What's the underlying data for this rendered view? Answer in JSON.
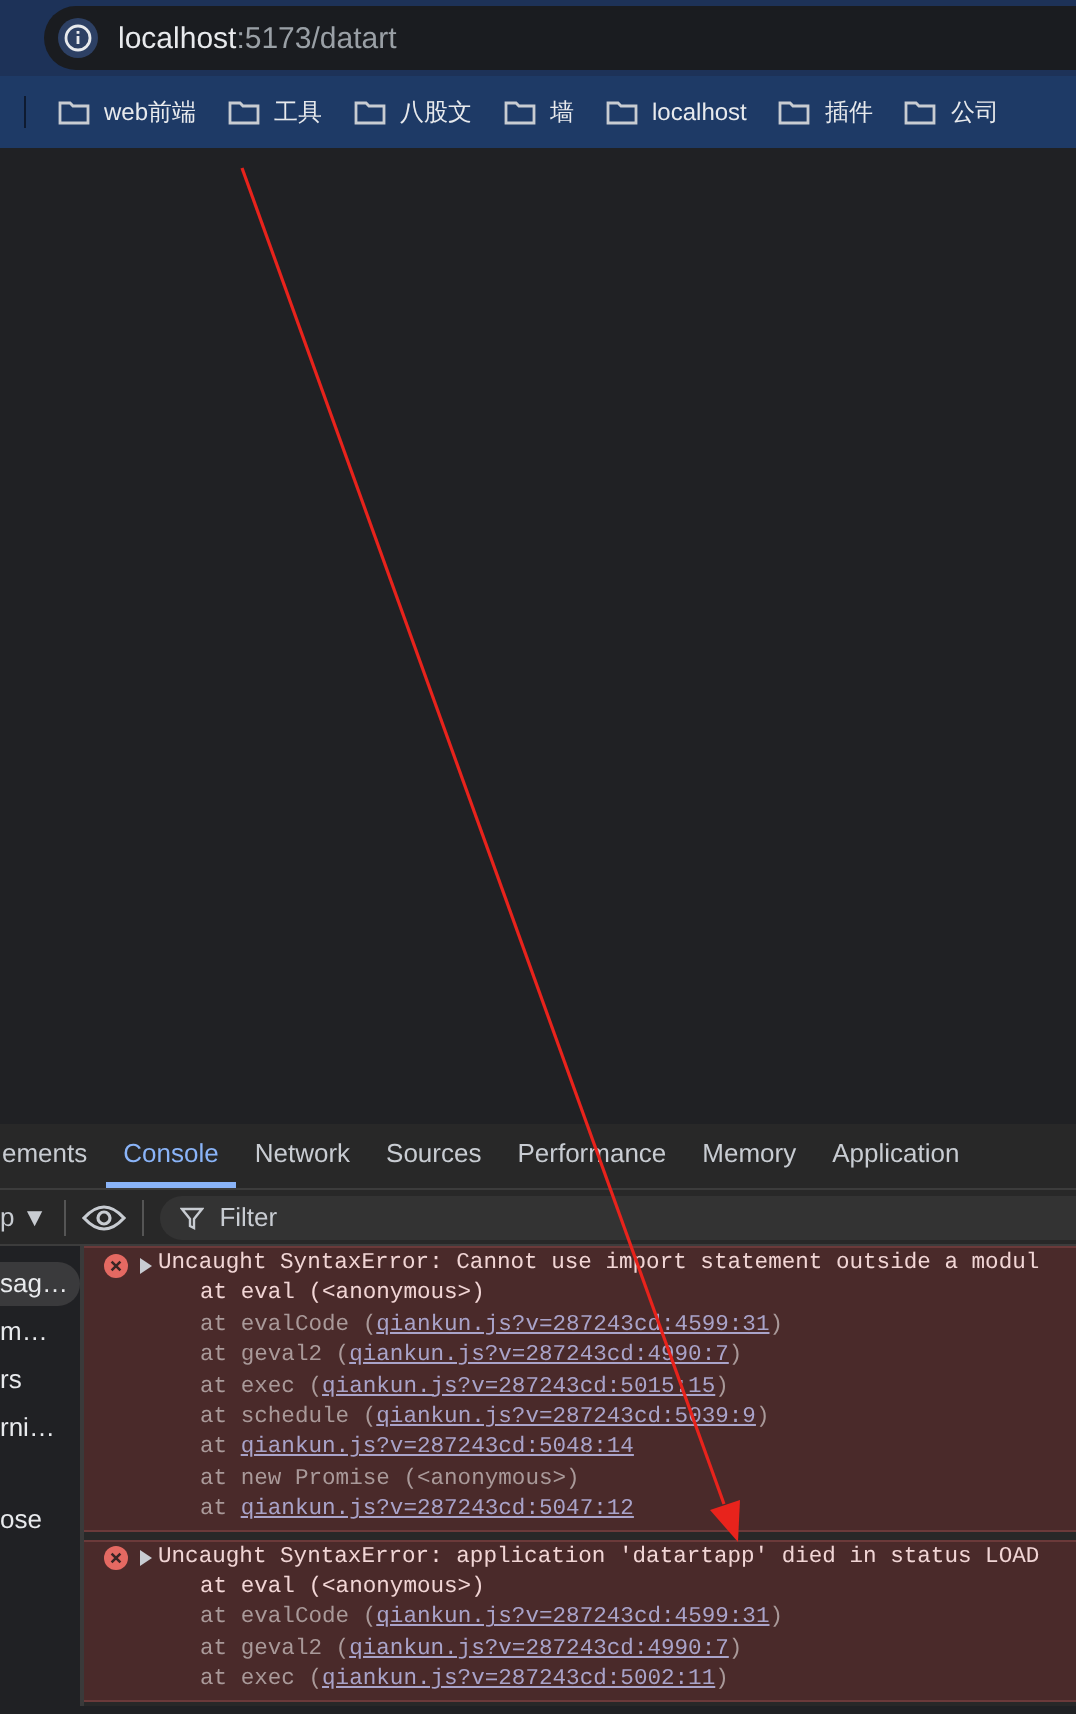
{
  "browser": {
    "address": {
      "host": "localhost",
      "path": ":5173/datart"
    },
    "bookmarks": [
      "web前端",
      "工具",
      "八股文",
      "墙",
      "localhost",
      "插件",
      "公司"
    ]
  },
  "devtools": {
    "tabs": [
      {
        "label": "ements",
        "selected": false
      },
      {
        "label": "Console",
        "selected": true
      },
      {
        "label": "Network",
        "selected": false
      },
      {
        "label": "Sources",
        "selected": false
      },
      {
        "label": "Performance",
        "selected": false
      },
      {
        "label": "Memory",
        "selected": false
      },
      {
        "label": "Application",
        "selected": false
      }
    ],
    "toolbar": {
      "context": "p ▼",
      "filter_placeholder": "Filter"
    },
    "sidebar": [
      {
        "label": "sag…",
        "selected": true
      },
      {
        "label": "m…",
        "selected": false
      },
      {
        "label": "rs",
        "selected": false
      },
      {
        "label": "rni…",
        "selected": false
      },
      {
        "label": "ose",
        "selected": false
      }
    ],
    "messages": [
      {
        "text": "Uncaught SyntaxError: Cannot use import statement outside a modul",
        "frames": [
          {
            "prefix": "at eval (<anonymous>)"
          },
          {
            "prefix": "at evalCode (",
            "link": "qiankun.js?v=287243cd:4599:31",
            "suffix": ")"
          },
          {
            "prefix": "at geval2 (",
            "link": "qiankun.js?v=287243cd:4990:7",
            "suffix": ")"
          },
          {
            "prefix": "at exec (",
            "link": "qiankun.js?v=287243cd:5015:15",
            "suffix": ")"
          },
          {
            "prefix": "at schedule (",
            "link": "qiankun.js?v=287243cd:5039:9",
            "suffix": ")"
          },
          {
            "prefix": "at ",
            "link": "qiankun.js?v=287243cd:5048:14"
          },
          {
            "prefix": "at new Promise (<anonymous>)"
          },
          {
            "prefix": "at ",
            "link": "qiankun.js?v=287243cd:5047:12"
          }
        ]
      },
      {
        "text": "Uncaught SyntaxError: application 'datartapp' died in status LOAD",
        "frames": [
          {
            "prefix": "at eval (<anonymous>)"
          },
          {
            "prefix": "at evalCode (",
            "link": "qiankun.js?v=287243cd:4599:31",
            "suffix": ")"
          },
          {
            "prefix": "at geval2 (",
            "link": "qiankun.js?v=287243cd:4990:7",
            "suffix": ")"
          },
          {
            "prefix": "at exec (",
            "link": "qiankun.js?v=287243cd:5002:11",
            "suffix": ")"
          }
        ]
      }
    ]
  }
}
